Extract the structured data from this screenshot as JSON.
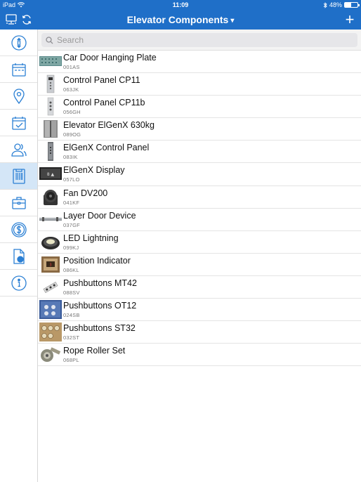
{
  "status": {
    "carrier": "iPad",
    "time": "11:09",
    "battery": "48%",
    "battery_level": 0.48
  },
  "nav": {
    "title": "Elevator Components"
  },
  "search": {
    "placeholder": "Search"
  },
  "sidebar": {
    "items": [
      {
        "icon": "elevator-icon",
        "active": false
      },
      {
        "icon": "calendar-icon",
        "active": false
      },
      {
        "icon": "location-pin-icon",
        "active": false
      },
      {
        "icon": "calendar-check-icon",
        "active": false
      },
      {
        "icon": "contacts-icon",
        "active": false
      },
      {
        "icon": "barcode-catalog-icon",
        "active": true
      },
      {
        "icon": "briefcase-icon",
        "active": false
      },
      {
        "icon": "dollar-icon",
        "active": false
      },
      {
        "icon": "document-globe-icon",
        "active": false
      },
      {
        "icon": "info-icon",
        "active": false
      }
    ]
  },
  "components": [
    {
      "name": "Car Door Hanging Plate",
      "code": "001AS"
    },
    {
      "name": "Control Panel CP11",
      "code": "063JK"
    },
    {
      "name": "Control Panel CP11b",
      "code": "056GH"
    },
    {
      "name": "Elevator ElGenX 630kg",
      "code": "089OG"
    },
    {
      "name": "ElGenX Control Panel",
      "code": "083IK"
    },
    {
      "name": "ElGenX Display",
      "code": "057LO"
    },
    {
      "name": "Fan DV200",
      "code": "041KF"
    },
    {
      "name": "Layer Door Device",
      "code": "037GF"
    },
    {
      "name": "LED Lightning",
      "code": "099KJ"
    },
    {
      "name": "Position Indicator",
      "code": "086KL"
    },
    {
      "name": "Pushbuttons MT42",
      "code": "088SV"
    },
    {
      "name": "Pushbuttons OT12",
      "code": "024SB"
    },
    {
      "name": "Pushbuttons ST32",
      "code": "032ST"
    },
    {
      "name": "Rope Roller Set",
      "code": "068PL"
    }
  ],
  "colors": {
    "accent": "#1f6fc8",
    "active_bg": "#d4e6f7"
  }
}
